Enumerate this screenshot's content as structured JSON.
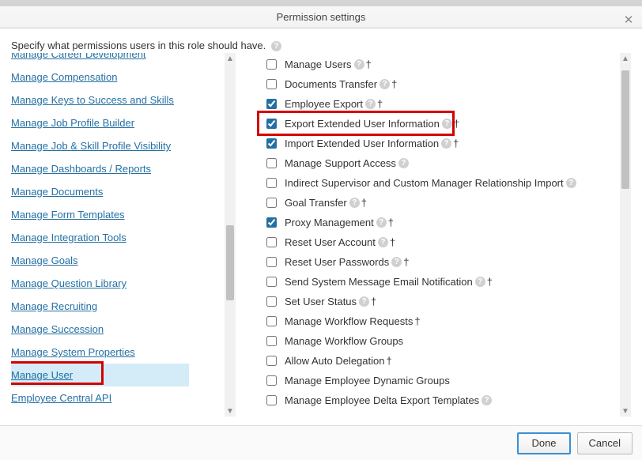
{
  "header": {
    "title": "Permission settings",
    "instruction": "Specify what permissions users in this role should have."
  },
  "left_categories": [
    {
      "label": "Manage Career Development",
      "selected": false,
      "truncated_top": true
    },
    {
      "label": "Manage Compensation",
      "selected": false
    },
    {
      "label": "Manage Keys to Success and Skills",
      "selected": false
    },
    {
      "label": "Manage Job Profile Builder",
      "selected": false
    },
    {
      "label": "Manage Job & Skill Profile Visibility",
      "selected": false
    },
    {
      "label": "Manage Dashboards / Reports",
      "selected": false
    },
    {
      "label": "Manage Documents",
      "selected": false
    },
    {
      "label": "Manage Form Templates",
      "selected": false
    },
    {
      "label": "Manage Integration Tools",
      "selected": false
    },
    {
      "label": "Manage Goals",
      "selected": false
    },
    {
      "label": "Manage Question Library",
      "selected": false
    },
    {
      "label": "Manage Recruiting",
      "selected": false
    },
    {
      "label": "Manage Succession",
      "selected": false
    },
    {
      "label": "Manage System Properties",
      "selected": false
    },
    {
      "label": "Manage User",
      "selected": true,
      "highlighted": true
    },
    {
      "label": "Employee Central API",
      "selected": false
    }
  ],
  "permissions": [
    {
      "label": "Manage Users",
      "checked": false,
      "help": true,
      "dagger": true
    },
    {
      "label": "Documents Transfer",
      "checked": false,
      "help": true,
      "dagger": true
    },
    {
      "label": "Employee Export",
      "checked": true,
      "help": true,
      "dagger": true
    },
    {
      "label": "Export Extended User Information",
      "checked": true,
      "help": true,
      "dagger": true,
      "highlighted": true
    },
    {
      "label": "Import Extended User Information",
      "checked": true,
      "help": true,
      "dagger": true
    },
    {
      "label": "Manage Support Access",
      "checked": false,
      "help": true,
      "dagger": false
    },
    {
      "label": "Indirect Supervisor and Custom Manager Relationship Import",
      "checked": false,
      "help": true,
      "dagger": false
    },
    {
      "label": "Goal Transfer",
      "checked": false,
      "help": true,
      "dagger": true
    },
    {
      "label": "Proxy Management",
      "checked": true,
      "help": true,
      "dagger": true
    },
    {
      "label": "Reset User Account",
      "checked": false,
      "help": true,
      "dagger": true
    },
    {
      "label": "Reset User Passwords",
      "checked": false,
      "help": true,
      "dagger": true
    },
    {
      "label": "Send System Message Email Notification",
      "checked": false,
      "help": true,
      "dagger": true
    },
    {
      "label": "Set User Status",
      "checked": false,
      "help": true,
      "dagger": true
    },
    {
      "label": "Manage Workflow Requests",
      "checked": false,
      "help": false,
      "dagger": true
    },
    {
      "label": "Manage Workflow Groups",
      "checked": false,
      "help": false,
      "dagger": false
    },
    {
      "label": "Allow Auto Delegation",
      "checked": false,
      "help": false,
      "dagger": true
    },
    {
      "label": "Manage Employee Dynamic Groups",
      "checked": false,
      "help": false,
      "dagger": false
    },
    {
      "label": "Manage Employee Delta Export Templates",
      "checked": false,
      "help": true,
      "dagger": false
    }
  ],
  "footer": {
    "done": "Done",
    "cancel": "Cancel"
  }
}
